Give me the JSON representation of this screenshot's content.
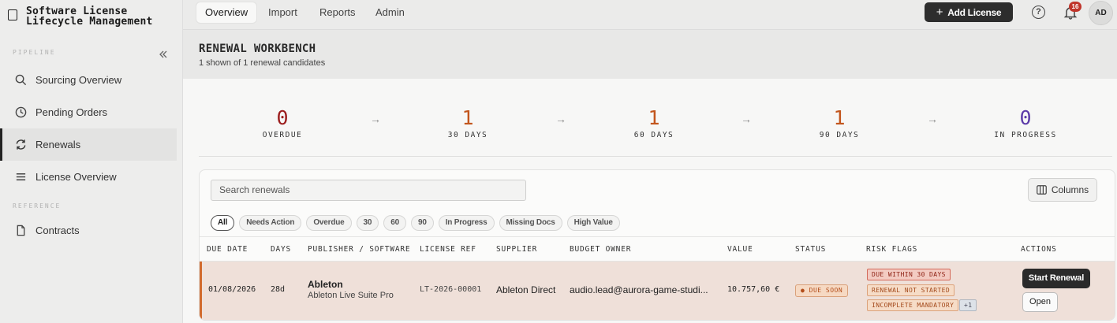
{
  "app": {
    "title_line1": "Software License",
    "title_line2": "Lifecycle Management"
  },
  "sidebar": {
    "sections": [
      {
        "label": "PIPELINE"
      },
      {
        "label": "REFERENCE"
      }
    ],
    "items": [
      {
        "label": "Sourcing Overview",
        "icon": "search-icon"
      },
      {
        "label": "Pending Orders",
        "icon": "clock-icon"
      },
      {
        "label": "Renewals",
        "icon": "refresh-icon",
        "active": true
      },
      {
        "label": "License Overview",
        "icon": "list-icon"
      },
      {
        "label": "Contracts",
        "icon": "document-icon"
      }
    ],
    "collapse_icon": "double-chevron-left-icon"
  },
  "topnav": {
    "tabs": [
      {
        "label": "Overview",
        "active": true
      },
      {
        "label": "Import"
      },
      {
        "label": "Reports"
      },
      {
        "label": "Admin"
      }
    ],
    "add_license_label": "Add License",
    "help_icon": "help-circle-icon",
    "bell_icon": "bell-icon",
    "notification_count": "16",
    "avatar_initials": "AD"
  },
  "header": {
    "title": "RENEWAL WORKBENCH",
    "subtitle": "1 shown of 1 renewal candidates"
  },
  "stats": [
    {
      "value": "0",
      "label": "OVERDUE",
      "color": "#9b1c1c"
    },
    {
      "value": "1",
      "label": "30 DAYS",
      "color": "#c2551c"
    },
    {
      "value": "1",
      "label": "60 DAYS",
      "color": "#c2551c"
    },
    {
      "value": "1",
      "label": "90 DAYS",
      "color": "#c2551c"
    },
    {
      "value": "0",
      "label": "IN PROGRESS",
      "color": "#5b3aa8"
    }
  ],
  "stat_arrow": "→",
  "table": {
    "search_placeholder": "Search renewals",
    "columns_button": "Columns",
    "filters": [
      "All",
      "Needs Action",
      "Overdue",
      "30",
      "60",
      "90",
      "In Progress",
      "Missing Docs",
      "High Value"
    ],
    "active_filter": "All",
    "headers": [
      "DUE DATE",
      "DAYS",
      "PUBLISHER / SOFTWARE",
      "LICENSE REF",
      "SUPPLIER",
      "BUDGET OWNER",
      "VALUE",
      "STATUS",
      "RISK FLAGS",
      "ACTIONS"
    ],
    "rows": [
      {
        "due_date": "01/08/2026",
        "days": "28d",
        "publisher": "Ableton",
        "software": "Ableton Live Suite Pro",
        "license_ref": "LT-2026-00001",
        "supplier": "Ableton Direct",
        "budget_owner": "audio.lead@aurora-game-studi...",
        "value": "10.757,60 €",
        "status": "DUE SOON",
        "risk_flags": [
          "DUE WITHIN 30 DAYS",
          "RENEWAL NOT STARTED",
          "INCOMPLETE MANDATORY"
        ],
        "risk_flags_more": "+1",
        "action_primary": "Start Renewal",
        "action_secondary": "Open"
      }
    ]
  }
}
